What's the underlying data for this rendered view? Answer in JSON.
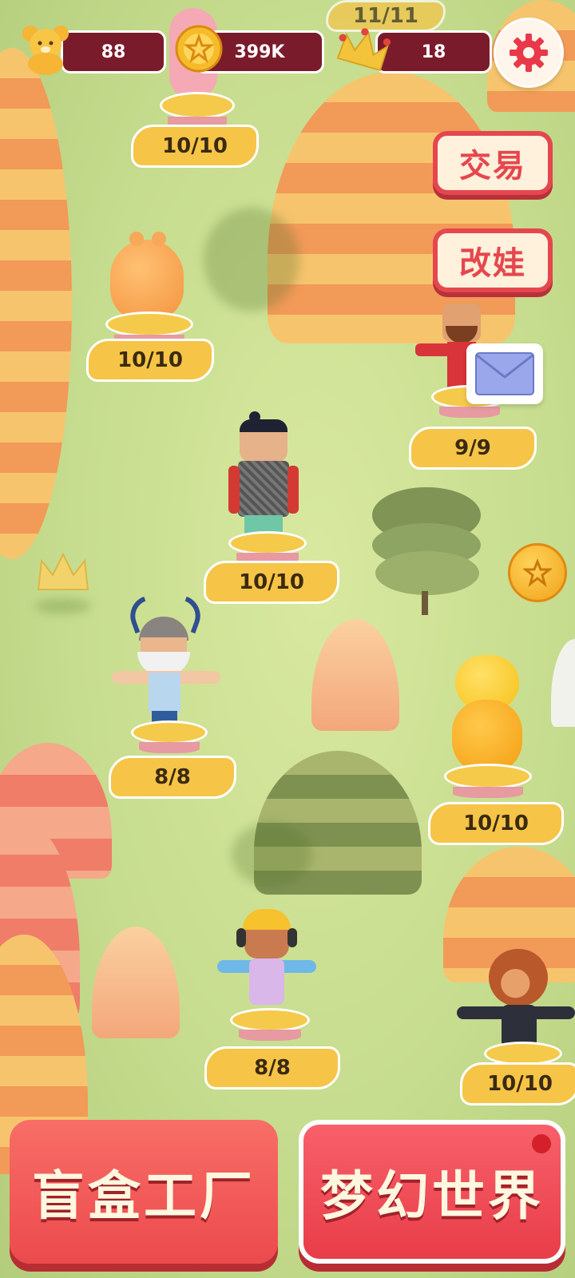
{
  "hud": {
    "bears": "88",
    "coins": "399K",
    "crowns": "18",
    "bears_icon": "teddy-bear-icon",
    "coins_icon": "coin-icon",
    "crowns_icon": "crown-icon",
    "settings_icon": "gear-icon"
  },
  "side_buttons": {
    "trade": "交易",
    "customize": "改娃"
  },
  "characters": [
    {
      "name": "bunny-pink",
      "progress": "10/10"
    },
    {
      "name": "bear-orange",
      "progress": "10/10"
    },
    {
      "name": "bearded-man",
      "progress": "9/9"
    },
    {
      "name": "armored-warrior",
      "progress": "10/10"
    },
    {
      "name": "viking",
      "progress": "8/8"
    },
    {
      "name": "cat-yellow",
      "progress": "10/10"
    },
    {
      "name": "headphone-kid",
      "progress": "8/8"
    },
    {
      "name": "monkey",
      "progress": "10/10"
    },
    {
      "name": "top-partial",
      "progress": "11/11"
    }
  ],
  "bottom": {
    "factory": "盲盒工厂",
    "dream_world": "梦幻世界"
  },
  "colors": {
    "accent_red": "#e5474e",
    "stat_bg": "#7a1b2c",
    "badge": "#f6c447"
  }
}
